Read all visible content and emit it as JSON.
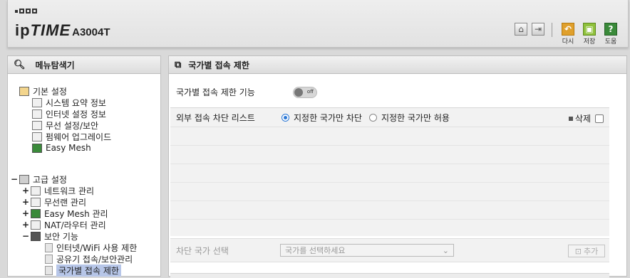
{
  "header": {
    "brand_ip": "ip",
    "brand_time": "TIME",
    "model": "A3004T",
    "buttons": [
      {
        "label": "다시",
        "color": "#e0a02c",
        "icon": "undo-icon"
      },
      {
        "label": "저장",
        "color": "#8fc13b",
        "icon": "save-icon"
      },
      {
        "label": "도움",
        "color": "#3a8a3a",
        "icon": "help-icon",
        "glyph": "?"
      }
    ]
  },
  "left": {
    "title": "메뉴탐색기",
    "basic": {
      "label": "기본 설정",
      "items": [
        "시스템 요약 정보",
        "인터넷 설정 정보",
        "무선 설정/보안",
        "펌웨어 업그레이드",
        "Easy Mesh"
      ]
    },
    "advanced": {
      "label": "고급 설정",
      "toggle": "−",
      "items": [
        {
          "pm": "+",
          "label": "네트워크 관리"
        },
        {
          "pm": "+",
          "label": "무선랜 관리"
        },
        {
          "pm": "+",
          "label": "Easy Mesh 관리"
        },
        {
          "pm": "+",
          "label": "NAT/라우터 관리"
        },
        {
          "pm": "−",
          "label": "보안 기능"
        }
      ],
      "security_items": [
        "인터넷/WiFi 사용 제한",
        "공유기 접속/보안관리",
        "국가별 접속 제한"
      ]
    }
  },
  "main": {
    "title": "국가별 접속 제한",
    "feature_label": "국가별 접속 제한 기능",
    "toggle_text": "off",
    "list_label": "외부 접속 차단 리스트",
    "radio1": "지정한 국가만 차단",
    "radio2": "지정한 국가만 허용",
    "delete_label": "삭제",
    "select_label": "차단 국가 선택",
    "select_placeholder": "국가를 선택하세요",
    "add_label": "추가"
  }
}
